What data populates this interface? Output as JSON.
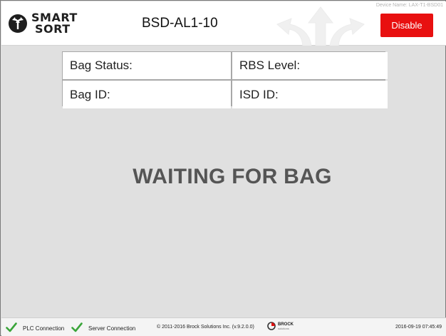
{
  "header": {
    "logo_line1": "SMART",
    "logo_line2": "SORT",
    "device_title": "BSD-AL1-10",
    "device_name": "Device Name: LAX-T1-BSD01",
    "disable_label": "Disable"
  },
  "info": {
    "bag_status_label": "Bag Status:",
    "rbs_level_label": "RBS Level:",
    "bag_id_label": "Bag ID:",
    "isd_id_label": "ISD ID:"
  },
  "status_message": "WAITING FOR BAG",
  "footer": {
    "plc_connection": "PLC Connection",
    "server_connection": "Server Connection",
    "copyright": "© 2011-2016 Brock Solutions Inc. (v.9.2.0.0)",
    "brock_name": "BROCK",
    "brock_sub": "solutions",
    "timestamp": "2016-09-19 07:45:49"
  },
  "colors": {
    "disable_button": "#e81010",
    "connection_ok": "#3aa53a",
    "background": "#e0e0e0"
  },
  "icons": {
    "logo": "smart-sort-logo-icon",
    "watermark": "sort-arrows-icon",
    "plc_status": "checkmark-icon",
    "server_status": "checkmark-icon",
    "brock_logo": "brock-logo-icon"
  }
}
